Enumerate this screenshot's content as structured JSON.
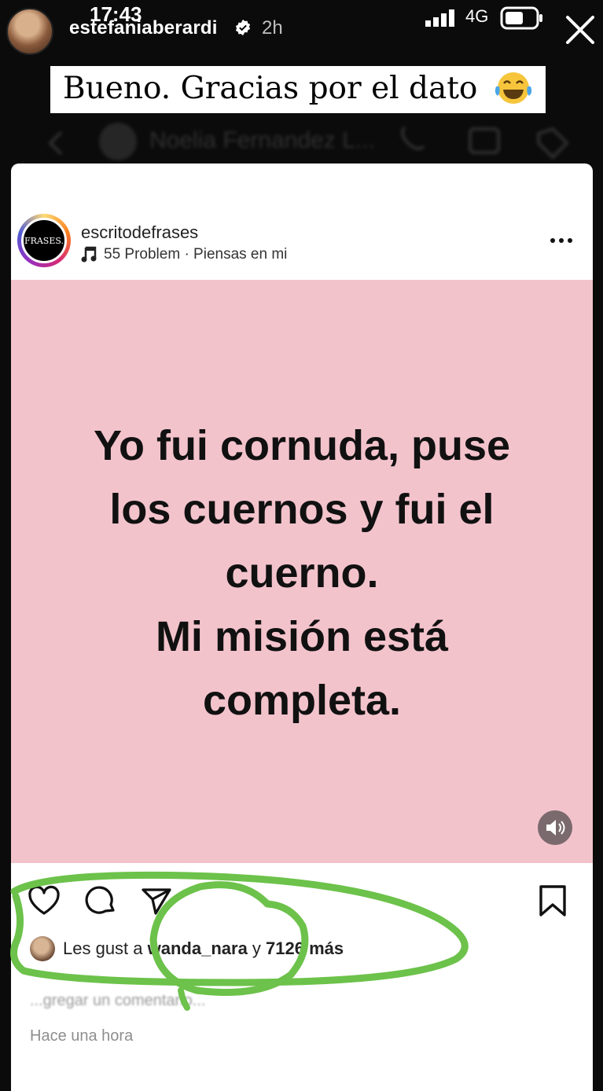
{
  "status_bar": {
    "clock": "17:43",
    "network": "4G"
  },
  "story": {
    "username": "estefaniaberardi",
    "time": "2h"
  },
  "caption": {
    "text": "Bueno. Gracias por el dato"
  },
  "background_chat": {
    "name": "Noelia Fernandez L..."
  },
  "post": {
    "username": "escritodefrases",
    "avatar_text": "FRASES.",
    "music": "55 Problem · Piensas en mi",
    "image_bg": "#f3c3cc",
    "quote_lines": [
      "Yo fui cornuda, puse",
      "los cuernos y fui el",
      "cuerno.",
      "Mi misión está",
      "completa."
    ],
    "likes": {
      "prefix": "Les gust",
      "mid": " a ",
      "user": "wanda_nara",
      "suffix": " y ",
      "count": "7126 más"
    },
    "comment_preview": "...gregar un comentario...",
    "time_ago": "Hace una hora"
  },
  "icons": [
    "verified-icon",
    "signal-icon",
    "battery-icon",
    "close-icon",
    "laugh-icon",
    "music-icon",
    "more-icon",
    "mute-icon",
    "like-icon",
    "comment-icon",
    "share-icon",
    "save-icon"
  ],
  "colors": {
    "highlight": "#6cc24a",
    "post_pink": "#f3c3cc"
  }
}
